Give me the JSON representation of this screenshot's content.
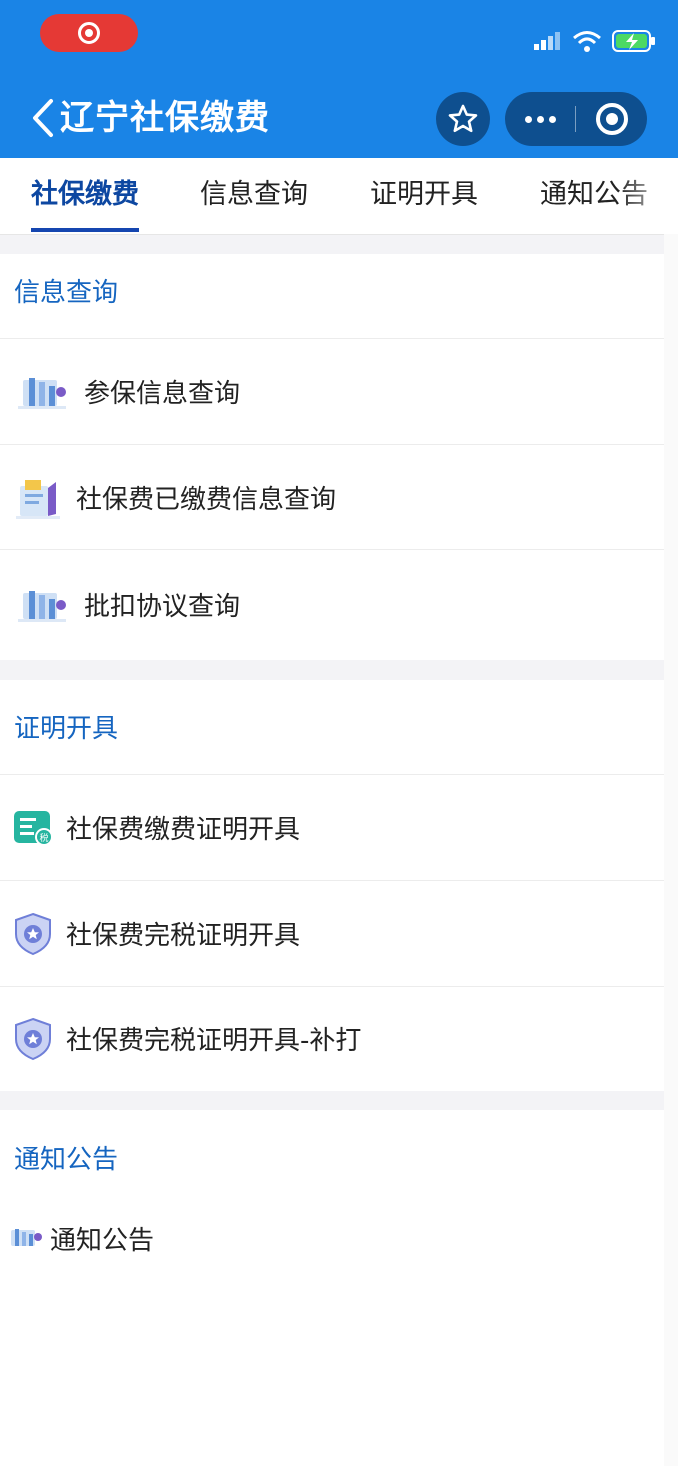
{
  "header": {
    "title": "辽宁社保缴费",
    "accent_color": "#1a84e6",
    "icons": {
      "record": "screen-record-icon",
      "back": "back-chevron-icon",
      "favorite": "star-icon",
      "more": "more-dots-icon",
      "close": "mini-program-close-icon"
    }
  },
  "tabs": [
    {
      "label": "社保缴费",
      "active": true
    },
    {
      "label": "信息查询",
      "active": false
    },
    {
      "label": "证明开具",
      "active": false
    },
    {
      "label": "通知公告",
      "active": false
    }
  ],
  "sections": [
    {
      "title": "信息查询",
      "items": [
        {
          "label": "参保信息查询",
          "icon": "data-illustration-icon"
        },
        {
          "label": "社保费已缴费信息查询",
          "icon": "document-illustration-icon"
        },
        {
          "label": "批扣协议查询",
          "icon": "data-illustration-icon"
        }
      ]
    },
    {
      "title": "证明开具",
      "items": [
        {
          "label": "社保费缴费证明开具",
          "icon": "tax-certificate-icon"
        },
        {
          "label": "社保费完税证明开具",
          "icon": "shield-icon"
        },
        {
          "label": "社保费完税证明开具-补打",
          "icon": "shield-icon"
        }
      ]
    },
    {
      "title": "通知公告",
      "items": [
        {
          "label": "通知公告",
          "icon": "notice-illustration-icon"
        }
      ]
    }
  ]
}
